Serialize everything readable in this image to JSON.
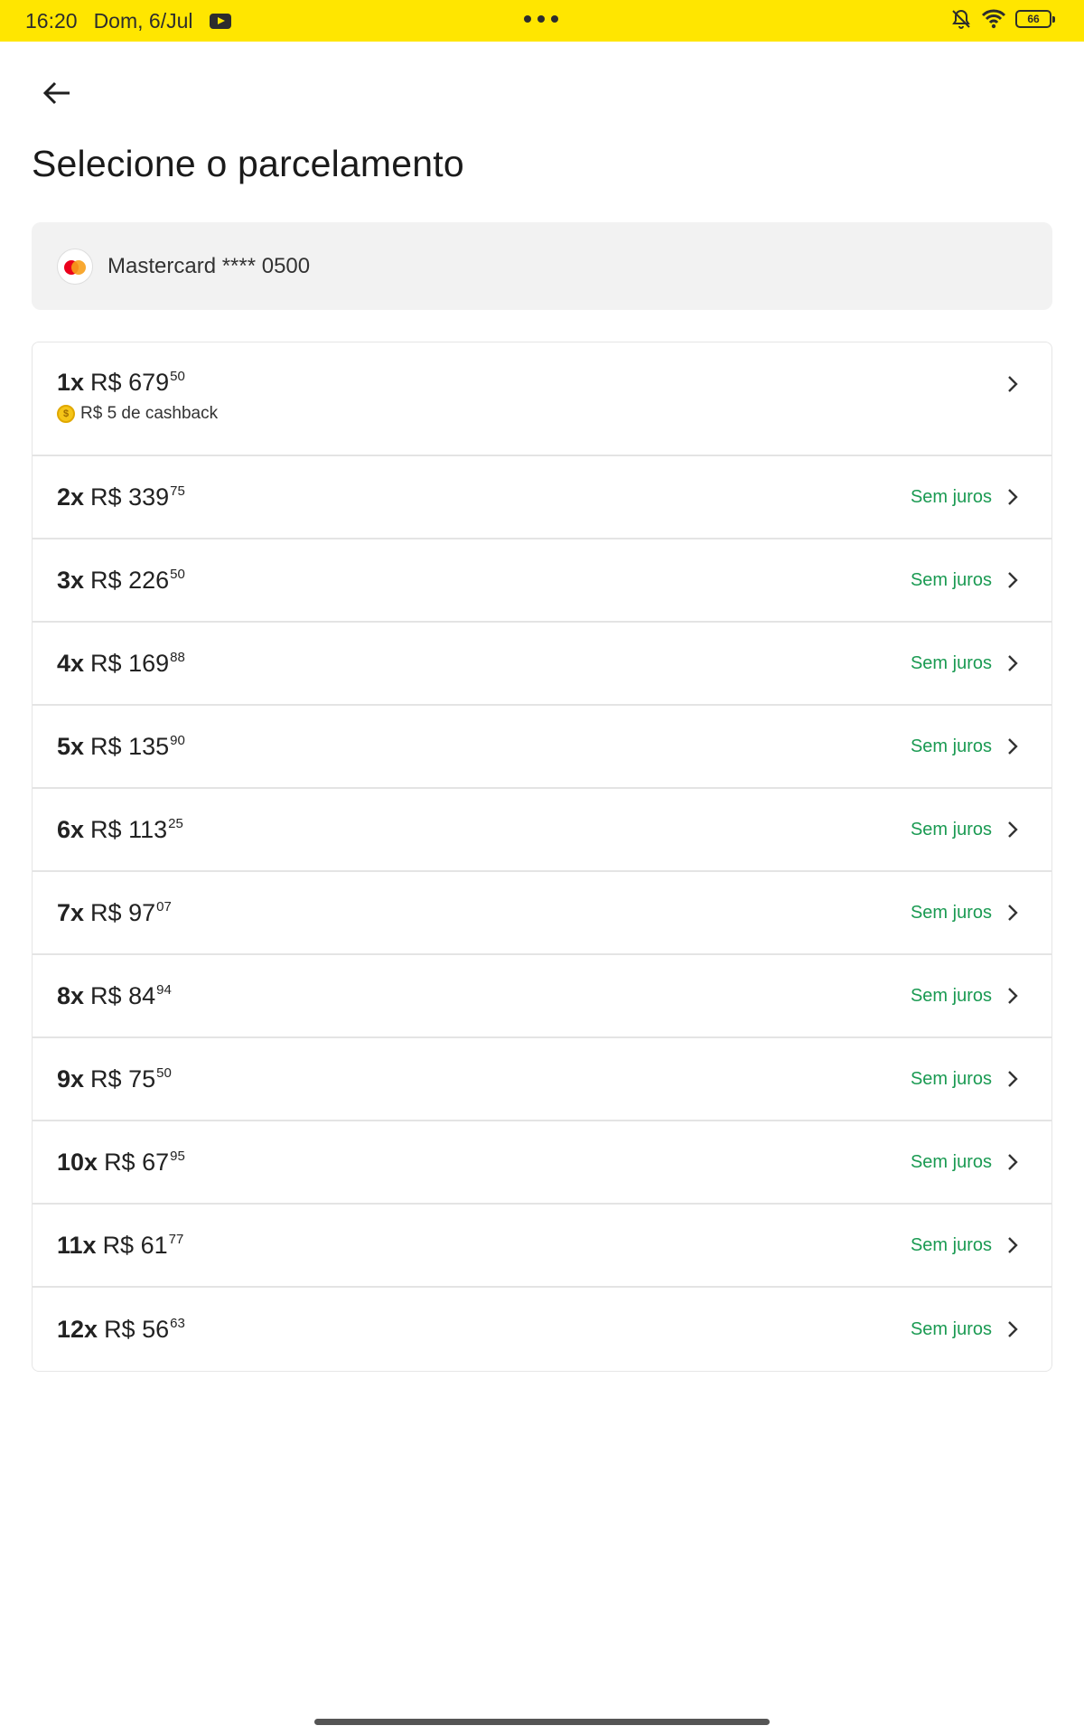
{
  "status_bar": {
    "time": "16:20",
    "date": "Dom, 6/Jul",
    "battery": "66",
    "icons": [
      "youtube-icon",
      "more-dots-icon",
      "bell-muted-icon",
      "wifi-icon",
      "battery-icon"
    ]
  },
  "header": {
    "back_icon": "arrow-left-icon",
    "title": "Selecione o parcelamento"
  },
  "card": {
    "brand_icon": "mastercard-icon",
    "label": "Mastercard **** 0500"
  },
  "installments": [
    {
      "qty": "1x",
      "amount": "R$ 679",
      "cents": "50",
      "cashback": "R$ 5 de cashback",
      "tag": ""
    },
    {
      "qty": "2x",
      "amount": "R$ 339",
      "cents": "75",
      "tag": "Sem juros"
    },
    {
      "qty": "3x",
      "amount": "R$ 226",
      "cents": "50",
      "tag": "Sem juros"
    },
    {
      "qty": "4x",
      "amount": "R$ 169",
      "cents": "88",
      "tag": "Sem juros"
    },
    {
      "qty": "5x",
      "amount": "R$ 135",
      "cents": "90",
      "tag": "Sem juros"
    },
    {
      "qty": "6x",
      "amount": "R$ 113",
      "cents": "25",
      "tag": "Sem juros"
    },
    {
      "qty": "7x",
      "amount": "R$ 97",
      "cents": "07",
      "tag": "Sem juros"
    },
    {
      "qty": "8x",
      "amount": "R$ 84",
      "cents": "94",
      "tag": "Sem juros"
    },
    {
      "qty": "9x",
      "amount": "R$ 75",
      "cents": "50",
      "tag": "Sem juros"
    },
    {
      "qty": "10x",
      "amount": "R$ 67",
      "cents": "95",
      "tag": "Sem juros"
    },
    {
      "qty": "11x",
      "amount": "R$ 61",
      "cents": "77",
      "tag": "Sem juros"
    },
    {
      "qty": "12x",
      "amount": "R$ 56",
      "cents": "63",
      "tag": "Sem juros"
    }
  ],
  "colors": {
    "status_bar": "#ffe600",
    "sem_juros": "#1a9a52",
    "card_bg": "#f2f2f2"
  }
}
